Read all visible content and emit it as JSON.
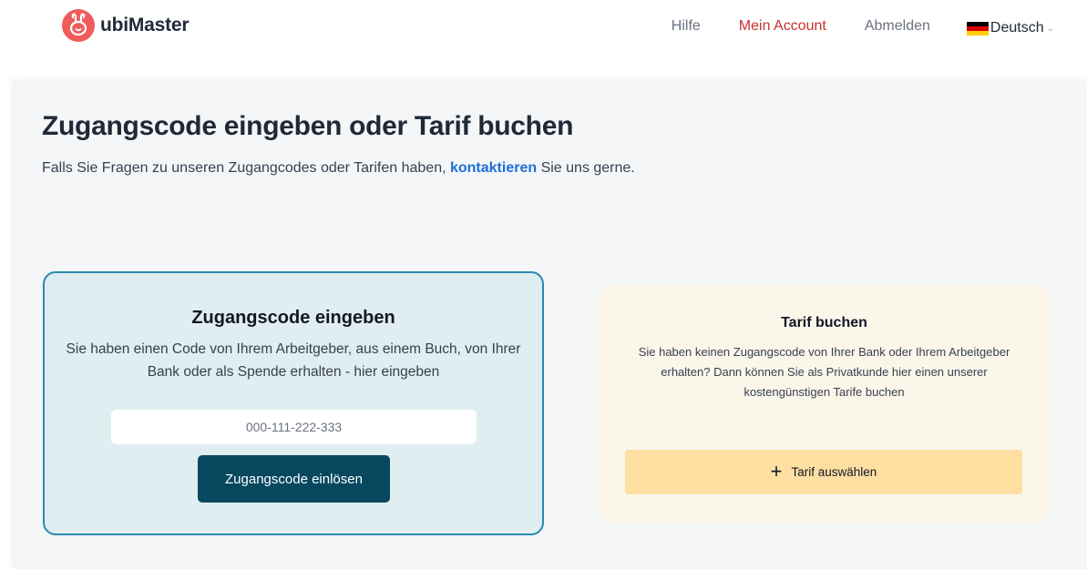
{
  "header": {
    "brand": "ubiMaster",
    "nav": {
      "help": "Hilfe",
      "account": "Mein Account",
      "logout": "Abmelden",
      "language": "Deutsch"
    }
  },
  "main": {
    "title": "Zugangscode eingeben oder Tarif buchen",
    "subtitle_before": "Falls Sie Fragen zu unseren Zugangcodes oder Tarifen haben, ",
    "subtitle_link": "kontaktieren",
    "subtitle_after": " Sie uns gerne."
  },
  "code_card": {
    "title": "Zugangscode eingeben",
    "description": "Sie haben einen Code von Ihrem Arbeitgeber, aus einem Buch, von Ihrer Bank oder als Spende erhalten - hier eingeben",
    "input_placeholder": "000-111-222-333",
    "input_value": "",
    "button_label": "Zugangscode einlösen"
  },
  "tarif_card": {
    "title": "Tarif buchen",
    "description": "Sie haben keinen Zugangscode von Ihrer Bank oder Ihrem Arbeitgeber erhalten? Dann können Sie als Privatkunde hier einen unserer kostengünstigen Tarife buchen",
    "button_label": "Tarif auswählen"
  },
  "colors": {
    "brand": "#ef5b5b",
    "active_nav": "#c53030",
    "link": "#1d6fd8",
    "primary_button": "#07485f",
    "code_card_bg": "#e0edf1",
    "code_card_border": "#2a8ab0",
    "tarif_card_bg": "#fbf6ea",
    "tarif_button": "#fddfa2"
  },
  "icons": {
    "logo": "rabbit-face-logo-icon",
    "language_flag": "german-flag-icon",
    "dropdown": "chevron-down-icon",
    "add": "plus-icon"
  }
}
